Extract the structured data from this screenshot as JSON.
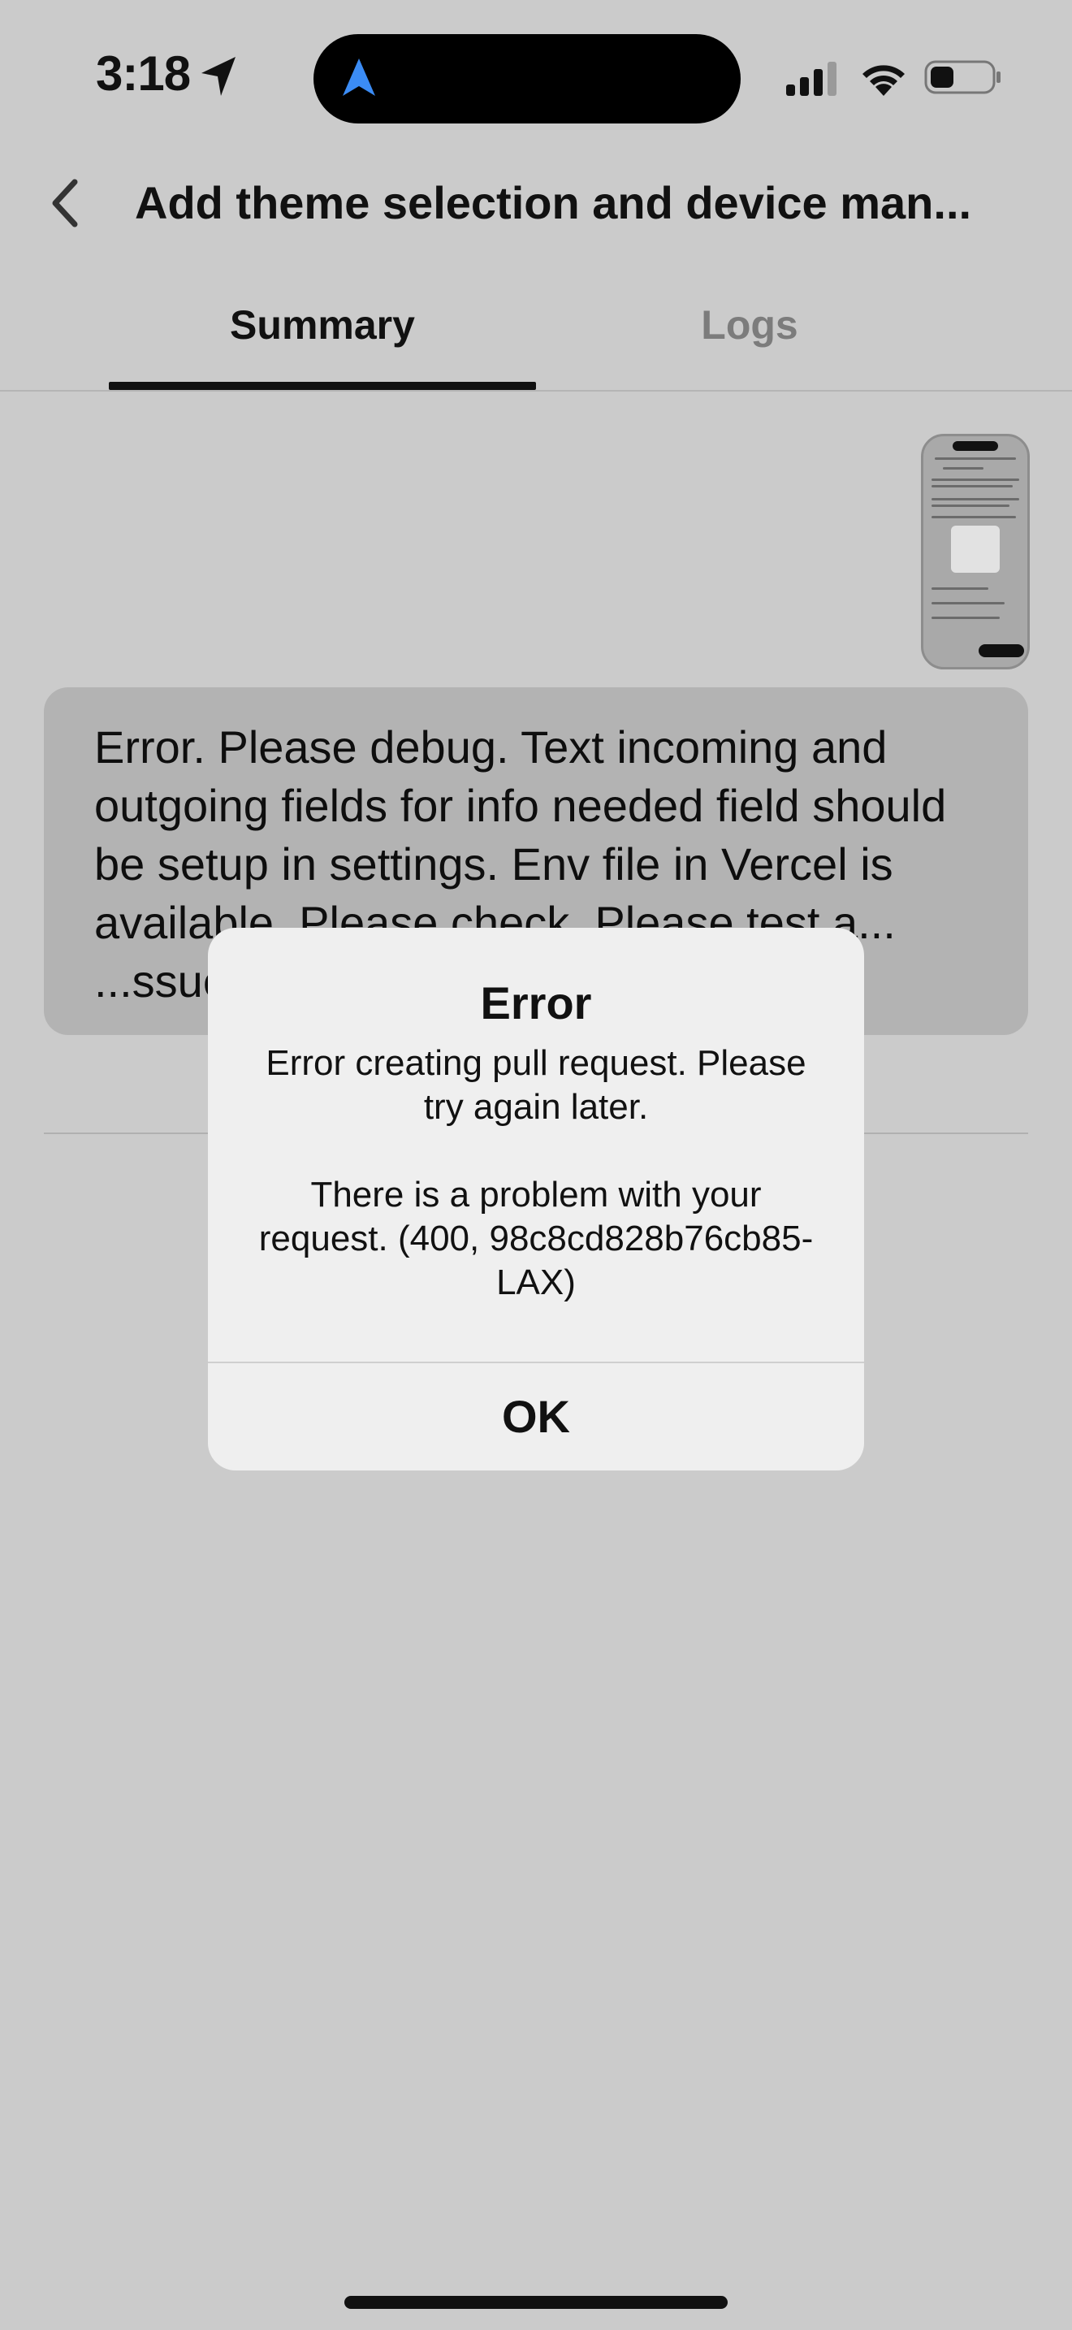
{
  "status_bar": {
    "time": "3:18",
    "location_icon": "location-arrow-icon",
    "island_icon": "navigation-arrow-icon",
    "island_icon_color": "#3b8cf5"
  },
  "header": {
    "back_icon": "chevron-left-icon",
    "title": "Add theme selection and device man..."
  },
  "tabs": [
    {
      "label": "Summary",
      "active": true
    },
    {
      "label": "Logs",
      "active": false
    }
  ],
  "message": {
    "text": "Error. Please debug. Text incoming and outgoing fields for info needed field should be setup in settings. Env file in Vercel is available. Please check. Please test a... ...ssue."
  },
  "alert": {
    "title": "Error",
    "message_line1": "Error creating pull request. Please try again later.",
    "message_line2": "There is a problem with your request. (400, 98c8cd828b76cb85-LAX)",
    "ok_label": "OK"
  }
}
